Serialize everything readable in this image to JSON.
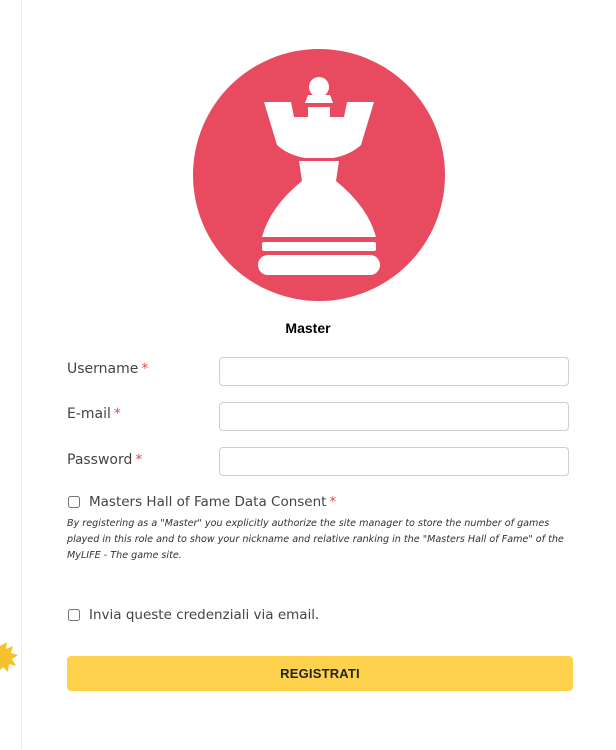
{
  "role": {
    "title": "Master",
    "icon": "chess-queen-icon",
    "badge_color": "#e84a5f"
  },
  "form": {
    "required_marker": "*",
    "fields": [
      {
        "label": "Username",
        "value": "",
        "placeholder": ""
      },
      {
        "label": "E-mail",
        "value": "",
        "placeholder": ""
      },
      {
        "label": "Password",
        "value": "",
        "placeholder": ""
      }
    ],
    "consent": {
      "label": "Masters Hall of Fame Data Consent",
      "checked": false,
      "text": "By registering as a \"Master\" you explicitly authorize the site manager to store the number of games played in this role and to show your nickname and relative ranking in the \"Masters Hall of Fame\" of the MyLIFE - The game site."
    },
    "email_credentials": {
      "label": "Invia queste credenziali via email.",
      "checked": false
    },
    "submit_label": "REGISTRATI",
    "submit_color": "#ffd24d"
  }
}
